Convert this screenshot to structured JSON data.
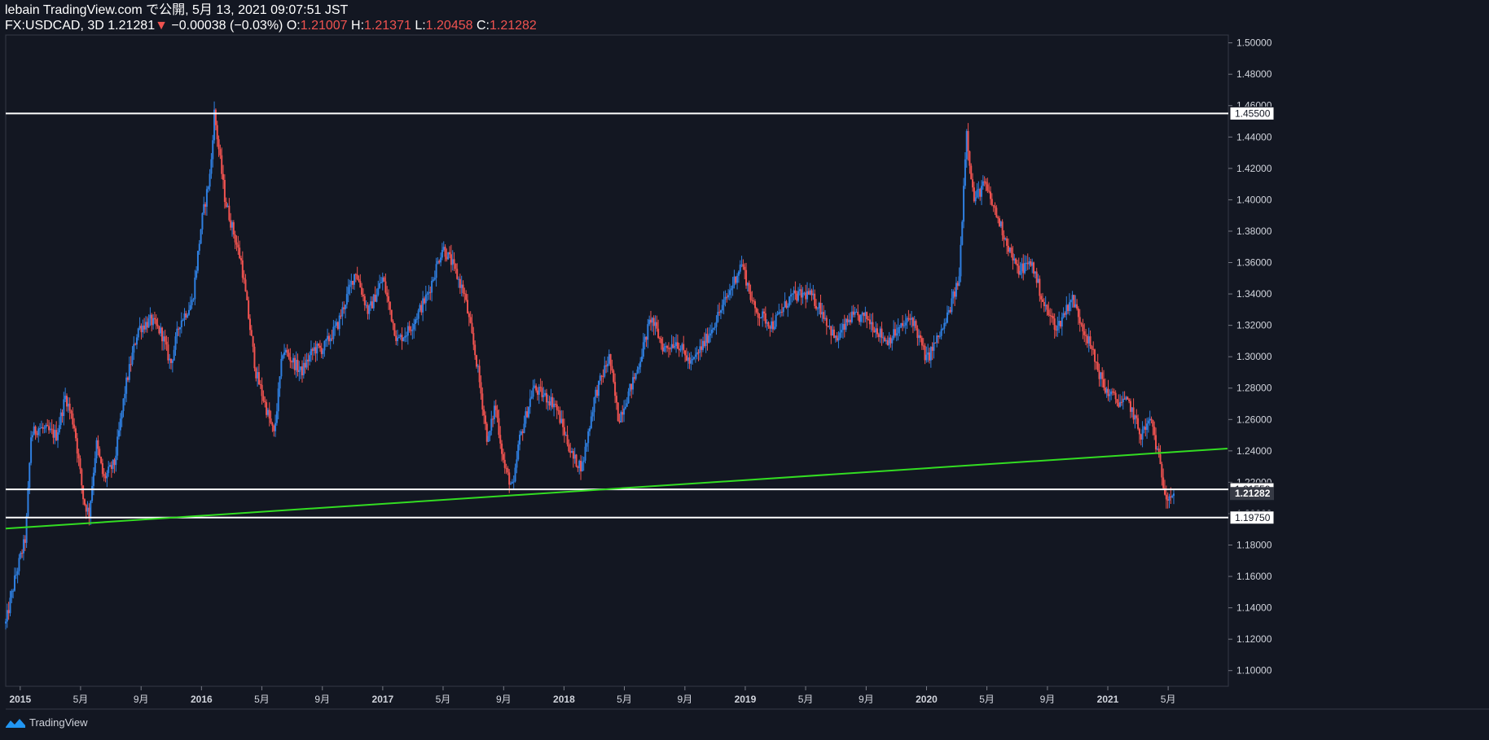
{
  "header": {
    "line1": "lebain TradingView.com で公開, 5月 13, 2021 09:07:51 JST",
    "symbol": "FX:USDCAD, 3D",
    "last": "1.21281",
    "change_arrow": "▼",
    "change": "−0.00038 (−0.03%)",
    "o_label": "O:",
    "o_value": "1.21007",
    "h_label": "H:",
    "h_value": "1.21371",
    "l_label": "L:",
    "l_value": "1.20458",
    "c_label": "C:",
    "c_value": "1.21282"
  },
  "footer": {
    "brand": "TradingView"
  },
  "colors": {
    "background": "#131722",
    "up": "#2f7fe0",
    "down": "#f05350",
    "trendline": "#33dd22",
    "level_line": "#ffffff"
  },
  "chart_data": {
    "type": "candlestick",
    "symbol": "FX:USDCAD",
    "timeframe": "3D",
    "ylim": [
      1.09,
      1.505
    ],
    "y_ticks": [
      "1.50000",
      "1.48000",
      "1.46000",
      "1.44000",
      "1.42000",
      "1.40000",
      "1.38000",
      "1.36000",
      "1.34000",
      "1.32000",
      "1.30000",
      "1.28000",
      "1.26000",
      "1.24000",
      "1.22000",
      "1.20000",
      "1.18000",
      "1.16000",
      "1.14000",
      "1.12000",
      "1.10000"
    ],
    "x_ticks": [
      {
        "label": "2015",
        "t": 2015.0,
        "bold": true
      },
      {
        "label": "5月",
        "t": 2015.333
      },
      {
        "label": "9月",
        "t": 2015.667
      },
      {
        "label": "2016",
        "t": 2016.0,
        "bold": true
      },
      {
        "label": "5月",
        "t": 2016.333
      },
      {
        "label": "9月",
        "t": 2016.667
      },
      {
        "label": "2017",
        "t": 2017.0,
        "bold": true
      },
      {
        "label": "5月",
        "t": 2017.333
      },
      {
        "label": "9月",
        "t": 2017.667
      },
      {
        "label": "2018",
        "t": 2018.0,
        "bold": true
      },
      {
        "label": "5月",
        "t": 2018.333
      },
      {
        "label": "9月",
        "t": 2018.667
      },
      {
        "label": "2019",
        "t": 2019.0,
        "bold": true
      },
      {
        "label": "5月",
        "t": 2019.333
      },
      {
        "label": "9月",
        "t": 2019.667
      },
      {
        "label": "2020",
        "t": 2020.0,
        "bold": true
      },
      {
        "label": "5月",
        "t": 2020.333
      },
      {
        "label": "9月",
        "t": 2020.667
      },
      {
        "label": "2021",
        "t": 2021.0,
        "bold": true
      },
      {
        "label": "5月",
        "t": 2021.333
      }
    ],
    "path_points": [
      [
        2014.92,
        1.13
      ],
      [
        2014.97,
        1.158
      ],
      [
        2015.03,
        1.185
      ],
      [
        2015.06,
        1.25
      ],
      [
        2015.1,
        1.255
      ],
      [
        2015.2,
        1.25
      ],
      [
        2015.25,
        1.275
      ],
      [
        2015.3,
        1.255
      ],
      [
        2015.35,
        1.208
      ],
      [
        2015.38,
        1.2
      ],
      [
        2015.42,
        1.245
      ],
      [
        2015.46,
        1.222
      ],
      [
        2015.52,
        1.232
      ],
      [
        2015.58,
        1.28
      ],
      [
        2015.65,
        1.318
      ],
      [
        2015.72,
        1.323
      ],
      [
        2015.78,
        1.315
      ],
      [
        2015.83,
        1.295
      ],
      [
        2015.88,
        1.322
      ],
      [
        2015.95,
        1.335
      ],
      [
        2016.0,
        1.385
      ],
      [
        2016.05,
        1.418
      ],
      [
        2016.07,
        1.456
      ],
      [
        2016.13,
        1.4
      ],
      [
        2016.22,
        1.36
      ],
      [
        2016.3,
        1.29
      ],
      [
        2016.4,
        1.25
      ],
      [
        2016.45,
        1.305
      ],
      [
        2016.55,
        1.29
      ],
      [
        2016.62,
        1.305
      ],
      [
        2016.67,
        1.305
      ],
      [
        2016.75,
        1.32
      ],
      [
        2016.85,
        1.355
      ],
      [
        2016.92,
        1.328
      ],
      [
        2017.0,
        1.35
      ],
      [
        2017.08,
        1.31
      ],
      [
        2017.15,
        1.318
      ],
      [
        2017.25,
        1.34
      ],
      [
        2017.33,
        1.37
      ],
      [
        2017.38,
        1.36
      ],
      [
        2017.45,
        1.34
      ],
      [
        2017.52,
        1.295
      ],
      [
        2017.58,
        1.245
      ],
      [
        2017.62,
        1.27
      ],
      [
        2017.67,
        1.23
      ],
      [
        2017.72,
        1.215
      ],
      [
        2017.75,
        1.245
      ],
      [
        2017.83,
        1.28
      ],
      [
        2017.95,
        1.27
      ],
      [
        2018.05,
        1.235
      ],
      [
        2018.1,
        1.23
      ],
      [
        2018.17,
        1.275
      ],
      [
        2018.25,
        1.3
      ],
      [
        2018.3,
        1.26
      ],
      [
        2018.4,
        1.29
      ],
      [
        2018.48,
        1.325
      ],
      [
        2018.55,
        1.305
      ],
      [
        2018.62,
        1.31
      ],
      [
        2018.7,
        1.295
      ],
      [
        2018.78,
        1.31
      ],
      [
        2018.9,
        1.338
      ],
      [
        2018.98,
        1.36
      ],
      [
        2019.05,
        1.33
      ],
      [
        2019.15,
        1.32
      ],
      [
        2019.25,
        1.338
      ],
      [
        2019.35,
        1.34
      ],
      [
        2019.42,
        1.33
      ],
      [
        2019.5,
        1.31
      ],
      [
        2019.58,
        1.325
      ],
      [
        2019.67,
        1.325
      ],
      [
        2019.78,
        1.31
      ],
      [
        2019.92,
        1.325
      ],
      [
        2020.0,
        1.298
      ],
      [
        2020.1,
        1.32
      ],
      [
        2020.18,
        1.35
      ],
      [
        2020.22,
        1.445
      ],
      [
        2020.26,
        1.4
      ],
      [
        2020.32,
        1.41
      ],
      [
        2020.42,
        1.38
      ],
      [
        2020.5,
        1.355
      ],
      [
        2020.58,
        1.36
      ],
      [
        2020.65,
        1.332
      ],
      [
        2020.72,
        1.318
      ],
      [
        2020.8,
        1.338
      ],
      [
        2020.9,
        1.308
      ],
      [
        2020.98,
        1.28
      ],
      [
        2021.05,
        1.272
      ],
      [
        2021.12,
        1.27
      ],
      [
        2021.18,
        1.25
      ],
      [
        2021.24,
        1.26
      ],
      [
        2021.28,
        1.235
      ],
      [
        2021.32,
        1.212
      ],
      [
        2021.36,
        1.2128
      ]
    ],
    "last_price": 1.21282,
    "levels": [
      {
        "price": 1.455,
        "label": "1.45500"
      },
      {
        "price": 1.2155,
        "label": "1.21550"
      },
      {
        "price": 1.1975,
        "label": "1.19750"
      }
    ],
    "last_label": "1.21282",
    "trendline": {
      "start": [
        2014.92,
        1.1905
      ],
      "end": [
        2021.66,
        1.2415
      ]
    }
  }
}
